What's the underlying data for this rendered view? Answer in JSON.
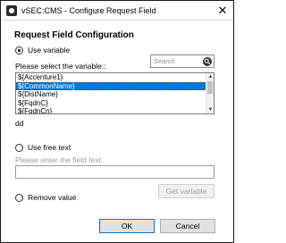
{
  "window": {
    "title": "vSEC:CMS - Configure Request Field",
    "close_glyph": "✕"
  },
  "heading": "Request Field Configuration",
  "use_variable": {
    "label": "Use variable",
    "checked": true,
    "select_label": "Please select the variable::",
    "search_placeholder": "Search",
    "items": [
      "${Accenture1}",
      "${CommonName}",
      "${DistName}",
      "${FqdnC}",
      "${FqdnCn}"
    ],
    "selected_index": 1,
    "selected_value_text": "dd"
  },
  "use_free_text": {
    "label": "Use free text",
    "checked": false,
    "input_label": "Please enter the field text:",
    "value": ""
  },
  "get_variable_button": "Get variable",
  "remove_value": {
    "label": "Remove value",
    "checked": false
  },
  "buttons": {
    "ok": "OK",
    "cancel": "Cancel"
  }
}
